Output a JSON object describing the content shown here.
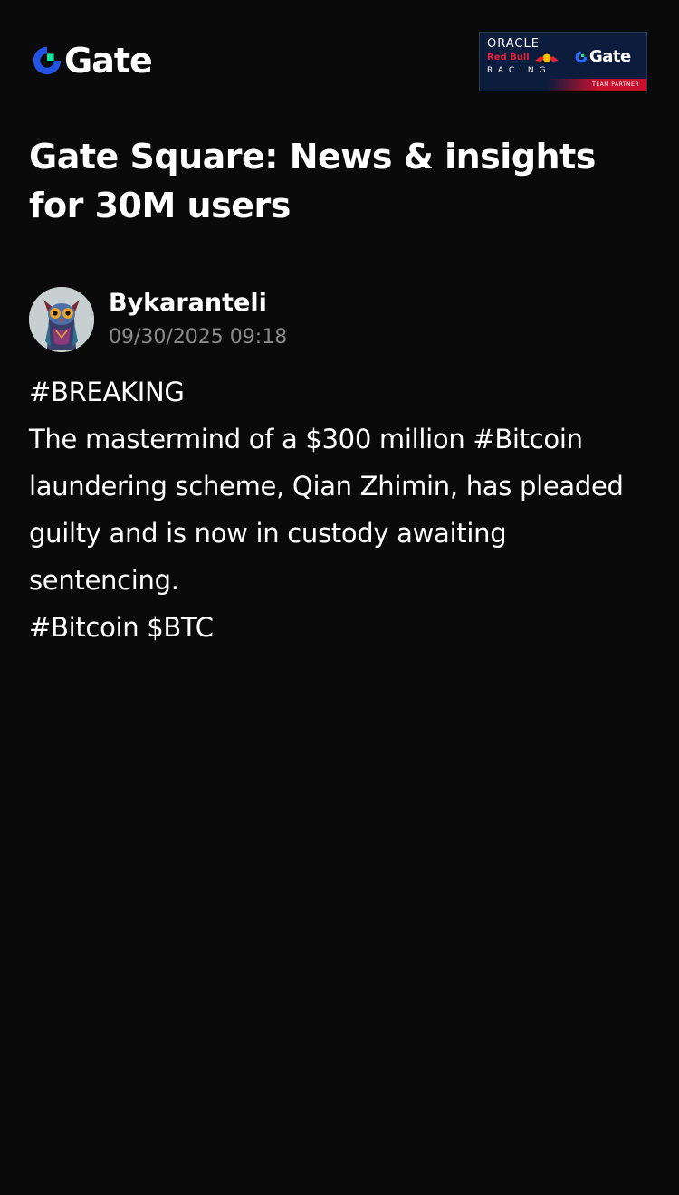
{
  "header": {
    "logo_text": "Gate",
    "partner_badge": {
      "oracle": "ORACLE",
      "red_bull": "Red Bull",
      "racing": "RACING",
      "gate": "Gate",
      "team_partner": "TEAM PARTNER"
    }
  },
  "page": {
    "title": "Gate Square: News & insights for 30M users"
  },
  "post": {
    "author": "Bykaranteli",
    "timestamp": "09/30/2025 09:18",
    "lines": [
      "#BREAKING",
      "The mastermind of a $300 million #Bitcoin",
      "laundering scheme, Qian Zhimin, has pleaded",
      "guilty and is now in custody awaiting",
      "sentencing.",
      "#Bitcoin $BTC"
    ]
  },
  "colors": {
    "background": "#0a0a0a",
    "text": "#ffffff",
    "muted_text": "#8a8a8a",
    "brand_blue": "#2354e6",
    "brand_green": "#17e6a1",
    "badge_navy": "#0b1c3c",
    "badge_red": "#c8102e"
  }
}
